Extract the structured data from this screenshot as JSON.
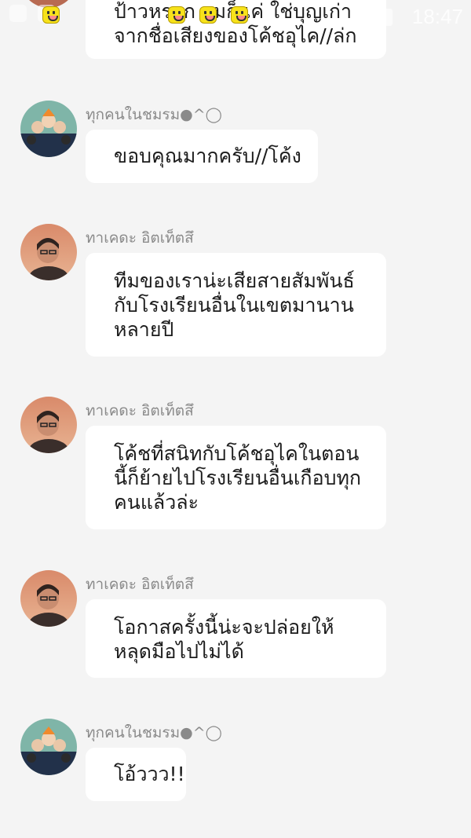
{
  "status_bar": {
    "time": "18:47"
  },
  "messages": [
    {
      "sender": "",
      "avatar": "boy-avatar-icon",
      "lines": [
        "ป้าวหรอก ผมก็แค่ ใช่บุญเก่า",
        "จากชื่อเสียงของโค้ชอุไค//ล่ก"
      ]
    },
    {
      "sender": "ทุกคนในชมรม●^◯",
      "avatar": "team-avatar-icon",
      "lines": [
        "ขอบคุณมากครับ//โค้ง"
      ]
    },
    {
      "sender": "ทาเคดะ อิตเท็ตสึ",
      "avatar": "teacher-avatar-icon",
      "lines": [
        "ทีมของเราน่ะเสียสายสัมพันธ์",
        "กับโรงเรียนอื่นในเขตมานาน",
        "หลายปี"
      ]
    },
    {
      "sender": "ทาเคดะ อิตเท็ตสึ",
      "avatar": "teacher-avatar-icon",
      "lines": [
        "โค้ชที่สนิทกับโค้ชอุไคในตอน",
        "นี้ก็ย้ายไปโรงเรียนอื่นเกือบทุก",
        "คนแล้วล่ะ"
      ]
    },
    {
      "sender": "ทาเคดะ อิตเท็ตสึ",
      "avatar": "teacher-avatar-icon",
      "lines": [
        "โอกาสครั้งนี้น่ะจะปล่อยให้",
        "หลุดมือไปไม่ได้"
      ]
    },
    {
      "sender": "ทุกคนในชมรม●^◯",
      "avatar": "team-avatar-icon",
      "lines": [
        "โอ้ววว!!"
      ]
    }
  ]
}
